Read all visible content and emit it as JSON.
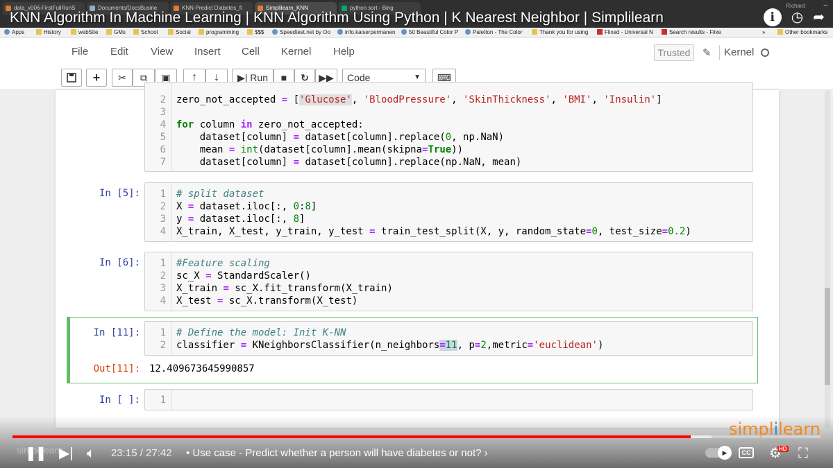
{
  "browser": {
    "tabs": [
      {
        "label": "data_v006-FirstFullRunS"
      },
      {
        "label": "Documents/DocsBusine"
      },
      {
        "label": "KNN-Predict Diabetes_fi"
      },
      {
        "label": "Simplilearn_KNN"
      },
      {
        "label": "python sort - Bing"
      }
    ],
    "user": "Richard",
    "bookmarks": [
      {
        "label": "Apps"
      },
      {
        "label": "History"
      },
      {
        "label": "webSite"
      },
      {
        "label": "GMs"
      },
      {
        "label": "School"
      },
      {
        "label": "Social"
      },
      {
        "label": "programming"
      },
      {
        "label": "$$$"
      },
      {
        "label": "Speedtest.net by Oo"
      },
      {
        "label": "info.kaiserpermanen"
      },
      {
        "label": "50 Beautiful Color P"
      },
      {
        "label": "Paletton - The Color"
      },
      {
        "label": "Thank you for using"
      },
      {
        "label": "Flixed - Universal N"
      },
      {
        "label": "Search results - Flixe"
      },
      {
        "label": "»"
      },
      {
        "label": "Other bookmarks"
      }
    ]
  },
  "video": {
    "title": "KNN Algorithm In Machine Learning | KNN Algorithm Using Python | K Nearest Neighbor | Simplilearn",
    "current_time": "23:15",
    "duration": "27:42",
    "time_display": "23:15 / 27:42",
    "chapter": "• Use case - Predict whether a person will have diabetes or not? ›",
    "progress_fraction": 0.839,
    "buffer_fraction": 0.865,
    "watermark": "simplilearn",
    "ghost": "simplilearn",
    "accent": "#ff0000"
  },
  "jupyter": {
    "menu": [
      "File",
      "Edit",
      "View",
      "Insert",
      "Cell",
      "Kernel",
      "Help"
    ],
    "trusted": "Trusted",
    "kernel": "Kernel",
    "toolbar": {
      "run_label": "Run",
      "cell_type": "Code"
    }
  },
  "cells": [
    {
      "prompt": "",
      "lines": [
        {
          "n": "2",
          "code": "zero_not_accepted = ['Glucose', 'BloodPressure', 'SkinThickness', 'BMI', 'Insulin']"
        },
        {
          "n": "3",
          "code": ""
        },
        {
          "n": "4",
          "code": "for column in zero_not_accepted:"
        },
        {
          "n": "5",
          "code": "    dataset[column] = dataset[column].replace(0, np.NaN)"
        },
        {
          "n": "6",
          "code": "    mean = int(dataset[column].mean(skipna=True))"
        },
        {
          "n": "7",
          "code": "    dataset[column] = dataset[column].replace(np.NaN, mean)"
        }
      ]
    },
    {
      "prompt": "In [5]:",
      "lines": [
        {
          "n": "1",
          "code": "# split dataset"
        },
        {
          "n": "2",
          "code": "X = dataset.iloc[:, 0:8]"
        },
        {
          "n": "3",
          "code": "y = dataset.iloc[:, 8]"
        },
        {
          "n": "4",
          "code": "X_train, X_test, y_train, y_test = train_test_split(X, y, random_state=0, test_size=0.2)"
        }
      ]
    },
    {
      "prompt": "In [6]:",
      "lines": [
        {
          "n": "1",
          "code": "#Feature scaling"
        },
        {
          "n": "2",
          "code": "sc_X = StandardScaler()"
        },
        {
          "n": "3",
          "code": "X_train = sc_X.fit_transform(X_train)"
        },
        {
          "n": "4",
          "code": "X_test = sc_X.transform(X_test)"
        }
      ]
    },
    {
      "prompt": "In [11]:",
      "lines": [
        {
          "n": "1",
          "code": "# Define the model: Init K-NN"
        },
        {
          "n": "2",
          "code": "classifier = KNeighborsClassifier(n_neighbors=11, p=2,metric='euclidean')"
        }
      ],
      "out_prompt": "Out[11]:",
      "output": "12.409673645990857"
    },
    {
      "prompt": "In [ ]:",
      "lines": [
        {
          "n": "1",
          "code": ""
        }
      ]
    }
  ]
}
